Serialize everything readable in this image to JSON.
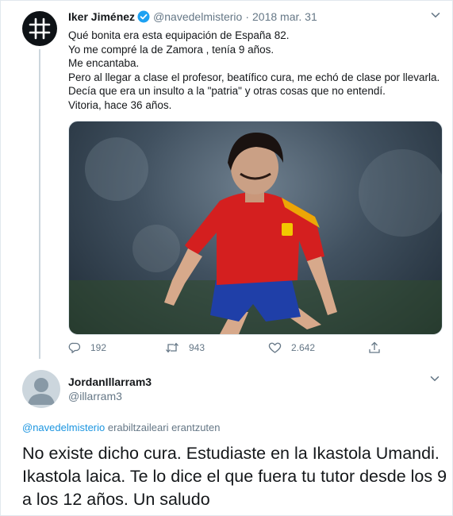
{
  "tweet": {
    "author_name": "Iker Jiménez",
    "author_handle": "@navedelmisterio",
    "separator": "·",
    "date": "2018 mar. 31",
    "lines": [
      "Qué bonita era esta equipación de España 82.",
      "Yo me compré la de Zamora , tenía 9 años.",
      "Me encantaba.",
      "Pero al llegar a clase el profesor, beatífico cura, me echó de clase por llevarla.",
      "Decía que era un insulto a la \"patria\" y otras cosas que no entendí.",
      "Vitoria, hace 36 años."
    ],
    "actions": {
      "reply_count": "192",
      "retweet_count": "943",
      "like_count": "2.642"
    }
  },
  "reply": {
    "author_name": "JordanIllarram3",
    "author_handle": "@illarram3",
    "replying_mention": "@navedelmisterio",
    "replying_text": " erabiltzaileari erantzuten",
    "lines": [
      "No existe dicho cura. Estudiaste en la Ikastola Umandi.",
      "Ikastola laica. Te lo dice el que fuera tu tutor desde los 9",
      "a los 12 años. Un saludo"
    ]
  },
  "icons": {
    "avatar1": "hashtag-logo-icon",
    "verified": "verified-badge-icon",
    "menu": "chevron-down-icon",
    "reply": "reply-icon",
    "retweet": "retweet-icon",
    "like": "heart-icon",
    "share": "share-icon",
    "avatar2": "default-avatar-icon"
  },
  "colors": {
    "link": "#1b95e0",
    "muted": "#657786",
    "text": "#14171a",
    "verified": "#1da1f2"
  }
}
